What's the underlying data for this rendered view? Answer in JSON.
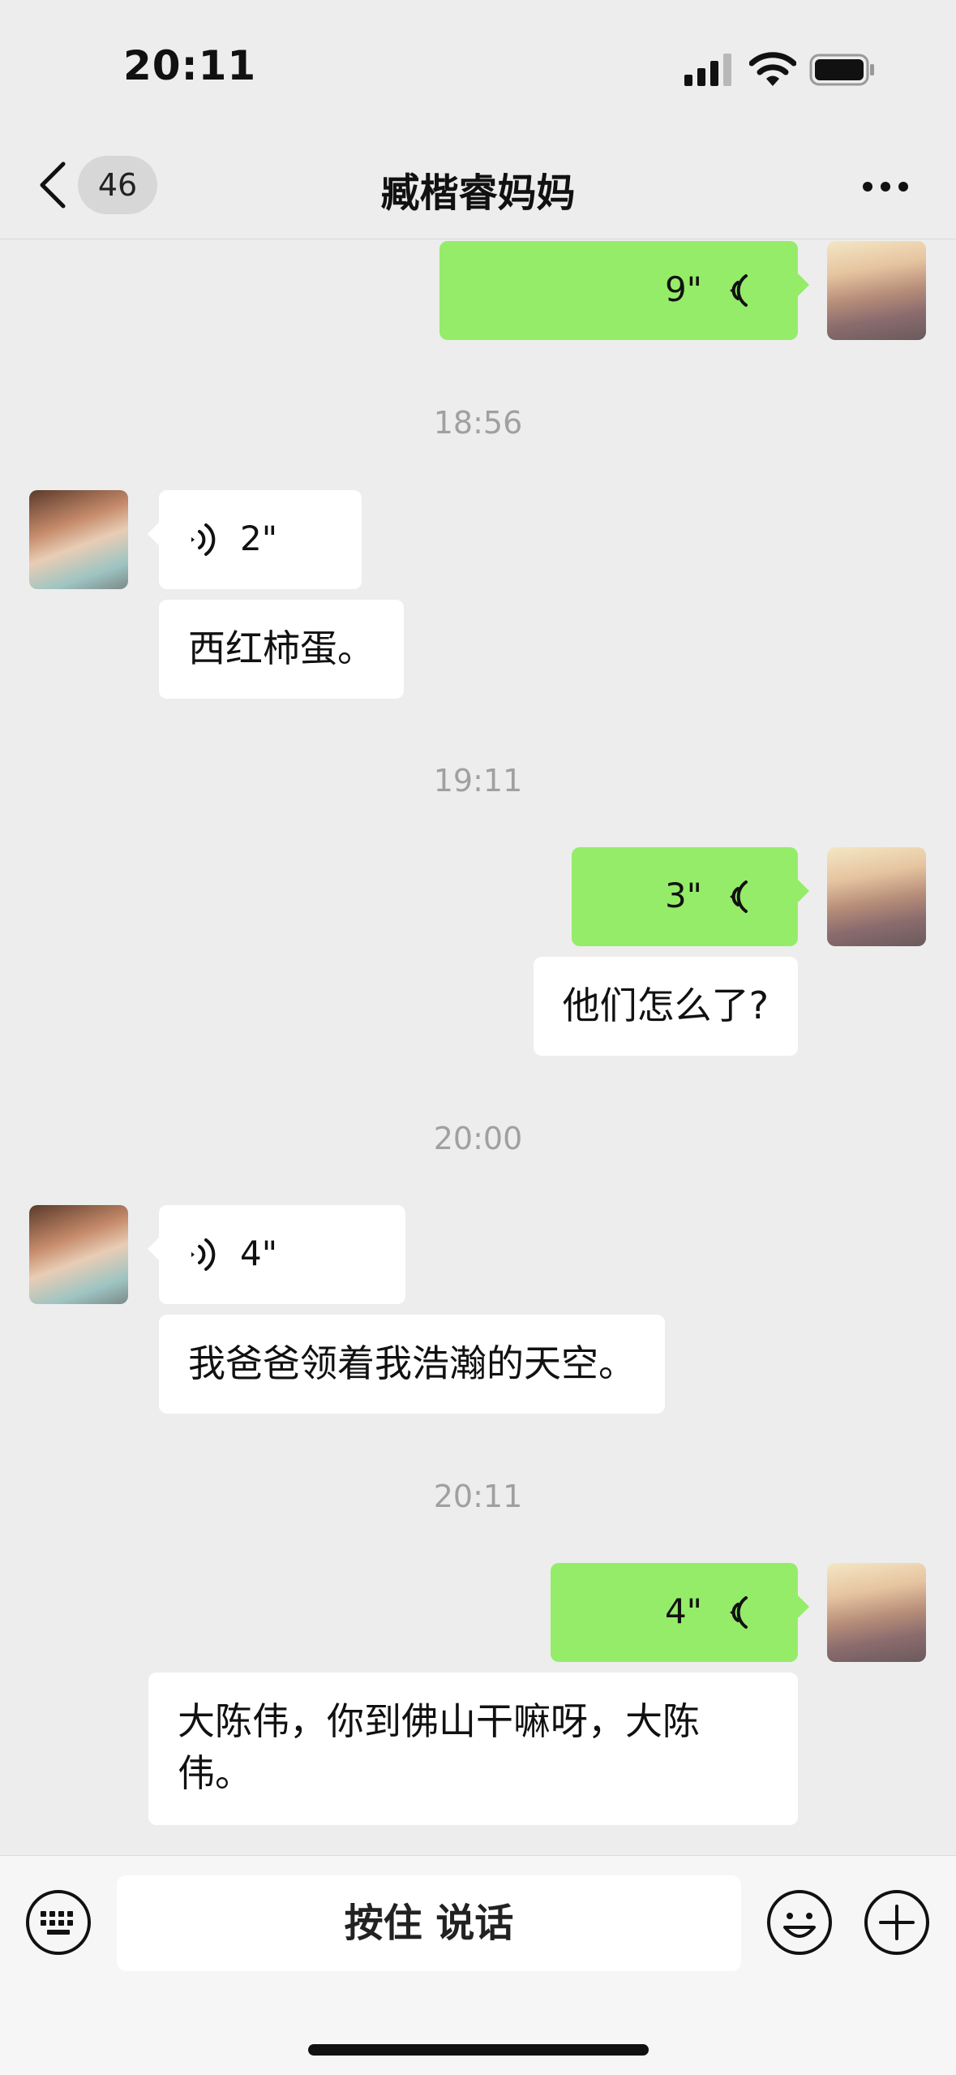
{
  "status_bar": {
    "time": "20:11"
  },
  "nav": {
    "badge_count": "46",
    "title": "臧楷睿妈妈"
  },
  "messages": {
    "m1_voice_out": {
      "duration": "9\""
    },
    "ts1": "18:56",
    "m2_voice_in": {
      "duration": "2\""
    },
    "m3_text_in": "西红柿蛋。",
    "ts2": "19:11",
    "m4_voice_out": {
      "duration": "3\""
    },
    "m5_text_out": "他们怎么了?",
    "ts3": "20:00",
    "m6_voice_in": {
      "duration": "4\""
    },
    "m7_text_in": "我爸爸领着我浩瀚的天空。",
    "ts4": "20:11",
    "m8_voice_out": {
      "duration": "4\""
    },
    "m9_text_out": "大陈伟，你到佛山干嘛呀，大陈伟。"
  },
  "input_bar": {
    "hold_to_talk_label": "按住 说话"
  },
  "icons": [
    "back-chevron-icon",
    "more-icon",
    "voice-wave-icon",
    "keyboard-icon",
    "emoji-icon",
    "plus-icon",
    "signal-icon",
    "wifi-icon",
    "battery-icon"
  ],
  "colors": {
    "background": "#ededed",
    "sent_bubble": "#95ec69",
    "received_bubble": "#ffffff",
    "timestamp_text": "#a0a0a0"
  }
}
